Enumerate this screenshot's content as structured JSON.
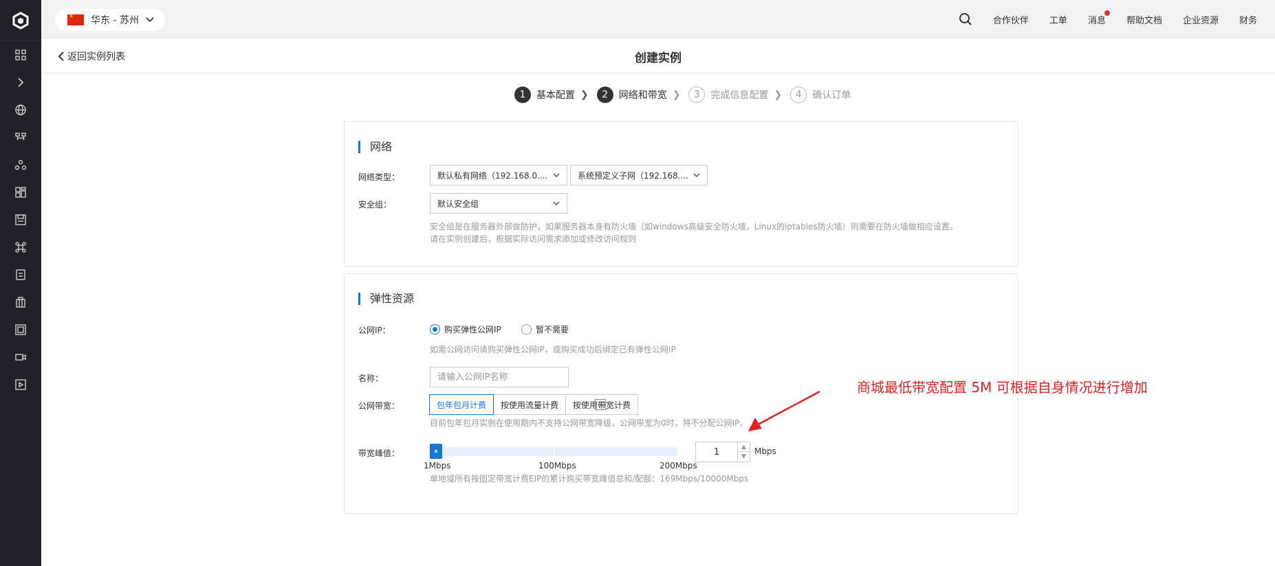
{
  "topbar": {
    "region": "华东 - 苏州",
    "nav": [
      "合作伙伴",
      "工单",
      "消息",
      "帮助文档",
      "企业资源",
      "财务"
    ]
  },
  "header": {
    "back_label": "返回实例列表",
    "title": "创建实例"
  },
  "steps": [
    {
      "num": "1",
      "label": "基本配置",
      "state": "done"
    },
    {
      "num": "2",
      "label": "网络和带宽",
      "state": "done"
    },
    {
      "num": "3",
      "label": "完成信息配置",
      "state": "todo"
    },
    {
      "num": "4",
      "label": "确认订单",
      "state": "todo"
    }
  ],
  "network": {
    "title": "网络",
    "type_label": "网络类型：",
    "vpc_value": "默认私有网络（192.168.0....",
    "subnet_value": "系统预定义子网（192.168....",
    "sg_label": "安全组：",
    "sg_value": "默认安全组",
    "sg_hint_1": "安全组是在服务器外部做防护，如果服务器本身有防火墙（如windows高级安全防火墙，Linux的iptables防火墙）则需要在防火墙做相应设置。",
    "sg_hint_2": "请在实例创建后，根据实际访问需求添加或修改访问规则"
  },
  "elastic": {
    "title": "弹性资源",
    "ip_label": "公网IP：",
    "ip_opt_buy": "购买弹性公网IP",
    "ip_opt_none": "暂不需要",
    "ip_hint": "如需公网访问请购买弹性公网IP，或购买成功后绑定已有弹性公网IP",
    "name_label": "名称：",
    "name_placeholder": "请输入公网IP名称",
    "bw_label": "公网带宽：",
    "bw_options": [
      "包年包月计费",
      "按使用流量计费",
      "按使用带宽计费"
    ],
    "bw_help": "?",
    "bw_hint": "目前包年包月实例在使用期内不支持公网带宽降级。公网带宽为0时，将不分配公网IP。",
    "peak_label": "带宽峰值：",
    "slider_labels": [
      "1Mbps",
      "100Mbps",
      "200Mbps"
    ],
    "slider_value_fraction": 0.0,
    "stepper_value": "1",
    "unit": "Mbps",
    "quota_hint": "单地域所有按固定带宽计费EIP的累计购买带宽峰值总和/配额：169Mbps/10000Mbps"
  },
  "annotation": "商城最低带宽配置 5M  可根据自身情况进行增加",
  "colors": {
    "accent": "#1677d2",
    "sidebar": "#1f2328",
    "annotation": "#e02020"
  }
}
